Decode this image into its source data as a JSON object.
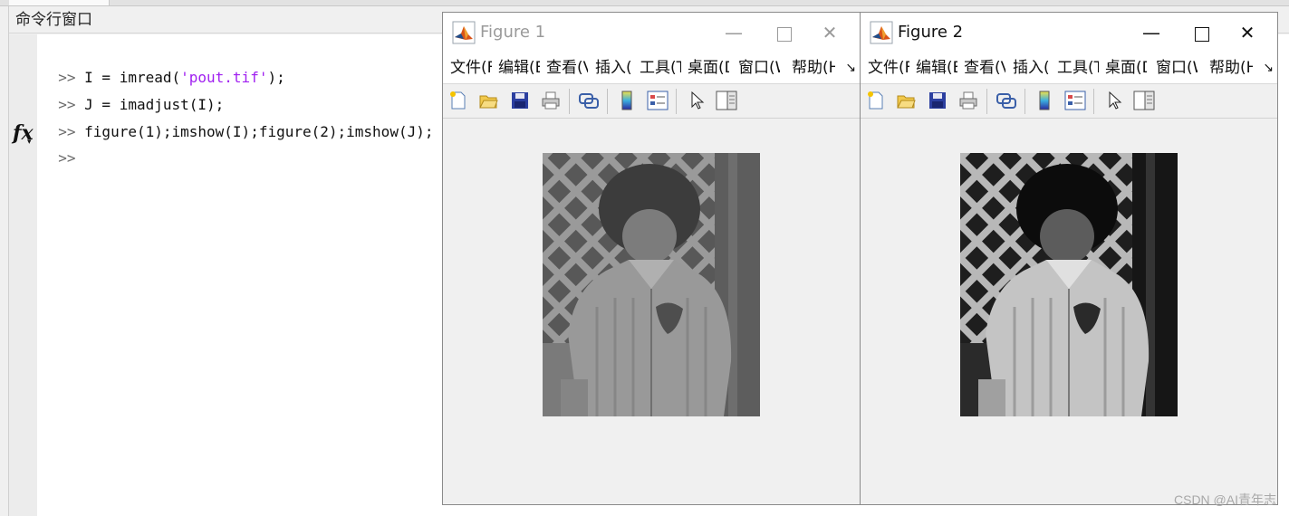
{
  "command_window": {
    "title": "命令行窗口",
    "lines": [
      {
        "prompt": ">>",
        "before": " I = imread(",
        "string": "'pout.tif'",
        "after": ");"
      },
      {
        "prompt": ">>",
        "text": " J = imadjust(I);"
      },
      {
        "prompt": ">>",
        "text": " figure(1);imshow(I);figure(2);imshow(J);"
      }
    ],
    "current_prompt": ">>",
    "fx_icon": "fx"
  },
  "figures": [
    {
      "title": "Figure 1",
      "state": "inactive",
      "menus": [
        "文件(F)",
        "编辑(E)",
        "查看(V)",
        "插入(I)",
        "工具(T)",
        "桌面(D)",
        "窗口(W)",
        "帮助(H)"
      ],
      "more_menu": "↘",
      "image": "pout.tif (original, low contrast)"
    },
    {
      "title": "Figure 2",
      "state": "active",
      "menus": [
        "文件(F)",
        "编辑(E)",
        "查看(V)",
        "插入(I)",
        "工具(T)",
        "桌面(D)",
        "窗口(W)",
        "帮助(H)"
      ],
      "more_menu": "↘",
      "image": "pout.tif after imadjust (high contrast)"
    }
  ],
  "toolbar_icons": [
    "new-figure-icon",
    "open-file-icon",
    "save-icon",
    "print-icon",
    "link-plot-icon",
    "colorbar-icon",
    "legend-icon",
    "pointer-icon",
    "property-editor-icon"
  ],
  "window_buttons": {
    "minimize": "—",
    "maximize": "□",
    "close": "✕"
  },
  "watermark": "CSDN @AI青年志",
  "colors": {
    "string_literal": "#a020f0",
    "background": "#f0f0f0",
    "inactive_title": "#9a9a9a"
  }
}
